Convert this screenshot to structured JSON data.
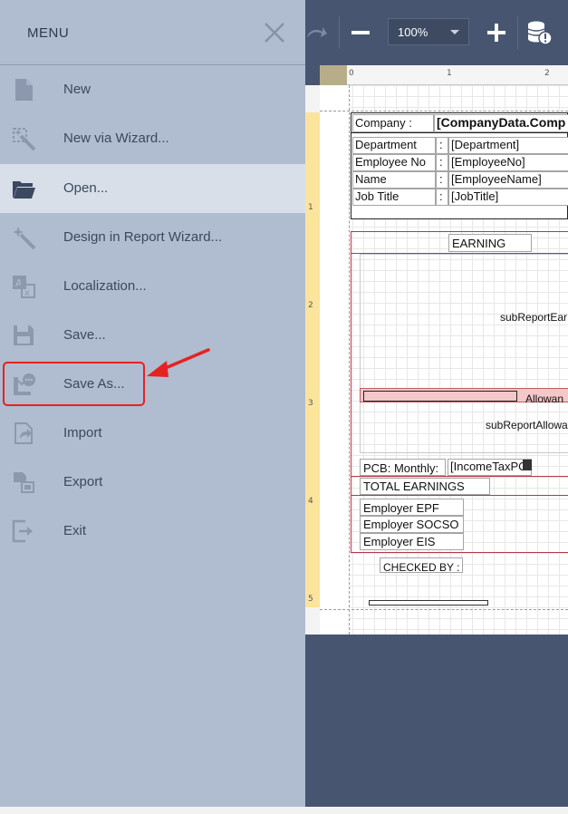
{
  "menu": {
    "title": "MENU",
    "items": [
      {
        "label": "New",
        "icon": "new-file-icon"
      },
      {
        "label": "New via Wizard...",
        "icon": "wizard-icon"
      },
      {
        "label": "Open...",
        "icon": "folder-open-icon",
        "active": true
      },
      {
        "label": "Design in Report Wizard...",
        "icon": "magic-wand-icon"
      },
      {
        "label": "Localization...",
        "icon": "localization-icon"
      },
      {
        "label": "Save...",
        "icon": "save-icon"
      },
      {
        "label": "Save As...",
        "icon": "save-as-icon"
      },
      {
        "label": "Import",
        "icon": "import-icon"
      },
      {
        "label": "Export",
        "icon": "export-icon"
      },
      {
        "label": "Exit",
        "icon": "exit-icon"
      }
    ]
  },
  "toolbar": {
    "zoom": "100%"
  },
  "ruler": {
    "h_marks": [
      "0",
      "1",
      "2"
    ],
    "v_marks": [
      "1",
      "2",
      "3",
      "4",
      "5"
    ]
  },
  "report": {
    "company_label": "Company :",
    "company_value": "[CompanyData.Comp",
    "rows": [
      {
        "label": "Department",
        "sep": ":",
        "value": "[Department]"
      },
      {
        "label": "Employee No",
        "sep": ":",
        "value": "[EmployeeNo]"
      },
      {
        "label": "Name",
        "sep": ":",
        "value": "[EmployeeName]"
      },
      {
        "label": "Job Title",
        "sep": ":",
        "value": "[JobTitle]"
      }
    ],
    "earning": "EARNING",
    "subreport_earning": "subReportEar",
    "allowance_header": "Allowan",
    "subreport_allowance": "subReportAllowa",
    "pcb_label": "PCB: Monthly:",
    "pcb_value": "[IncomeTaxPC",
    "total_earnings": "TOTAL EARNINGS",
    "employer": [
      "Employer EPF",
      "Employer SOCSO",
      "Employer EIS"
    ],
    "checked_by": "CHECKED BY :"
  },
  "colors": {
    "menu_bg": "#b0bccf",
    "menu_active": "#d8dfe9",
    "designer_bg": "#475570",
    "highlight": "#e52222"
  }
}
